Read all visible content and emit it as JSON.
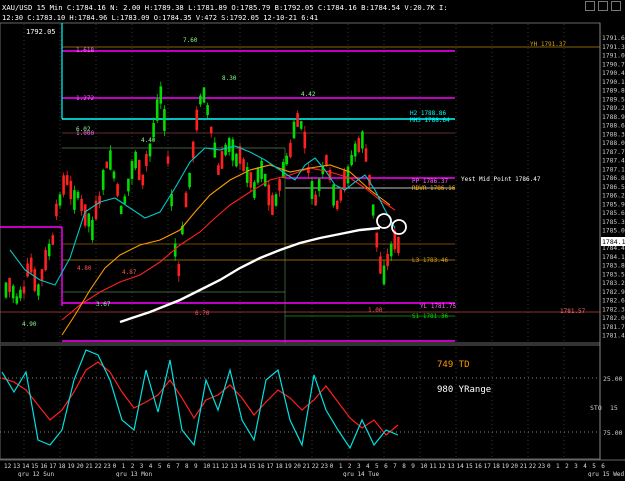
{
  "header": {
    "line1": "XAU/USD 15 Min  C:1784.16  N:  2.00  H:1789.38  L:1781.89  O:1785.79  B:1792.05  C:1784.16  B:1784.54  V:20.7K  I:",
    "line2": "12:30 C:1783.10  H:1784.96  L:1783.09  O:1784.35  V:472  S:1792.05  12-10-21  6:41",
    "top_value": "1792.05"
  },
  "price_axis": {
    "labels": [
      "1791.60",
      "1791.30",
      "1791.00",
      "1790.70",
      "1790.40",
      "1790.10",
      "1789.80",
      "1789.50",
      "1789.20",
      "1788.90",
      "1788.60",
      "1788.30",
      "1788.00",
      "1787.70",
      "1787.40",
      "1787.10",
      "1786.80",
      "1786.50",
      "1786.20",
      "1785.90",
      "1785.60",
      "1785.30",
      "1785.00",
      "1784.70",
      "1784.40",
      "1784.10",
      "1783.80",
      "1783.50",
      "1783.20",
      "1782.90",
      "1782.60",
      "1782.30",
      "1782.00",
      "1781.70",
      "1781.40"
    ],
    "current": "1784.16"
  },
  "levels": {
    "yh": "YH 1791.37",
    "h2": "H2 1788.86",
    "mh3": "MH3 1788.64",
    "yest_mid": "Yest Mid Point 1786.47",
    "pp": "PP 1786.37",
    "rdvr": "RDVR 1786.16",
    "l3": "L3 1783.46",
    "yl": "YL 1781.75",
    "l_low": "1781.57",
    "s1": "S1 1781.36"
  },
  "fib_labels": [
    "1.618",
    "1.272",
    "1.000",
    "7.60",
    "8.30",
    "4.42",
    "6.02",
    "4.40",
    "4.87",
    "4.80",
    "4.90",
    "3.67",
    "6.70",
    "1.00"
  ],
  "indicator": {
    "td": "749 TD",
    "yrange": "980 YRange",
    "sto_label": "STO",
    "levels": [
      "25.00",
      "15",
      "75.00"
    ]
  },
  "time_axis": {
    "labels": [
      "12",
      "13",
      "14",
      "15",
      "16",
      "17",
      "18",
      "19",
      "20",
      "21",
      "22",
      "23",
      "0",
      "1",
      "2",
      "3",
      "4",
      "5",
      "6",
      "7",
      "8",
      "9",
      "10",
      "11",
      "12",
      "13",
      "14",
      "15",
      "16",
      "17",
      "18",
      "19",
      "20",
      "21",
      "22",
      "23",
      "0",
      "1",
      "2",
      "3",
      "4",
      "5",
      "6",
      "7",
      "8",
      "9",
      "10",
      "11",
      "12",
      "13",
      "14",
      "15",
      "16",
      "17",
      "18",
      "19",
      "20",
      "21",
      "22",
      "23",
      "0",
      "1",
      "2",
      "3",
      "4",
      "5",
      "6"
    ],
    "date_labels": [
      "gru 12 Sun",
      "gru 13 Mon",
      "gru 14 Tue",
      "gru 15 Wed"
    ]
  },
  "colors": {
    "magenta": "#ff00ff",
    "cyan": "#00ffff",
    "white": "#ffffff",
    "red": "#ff2020",
    "orange": "#ff9a00",
    "green": "#00dd00",
    "teal": "#00c8c8"
  }
}
